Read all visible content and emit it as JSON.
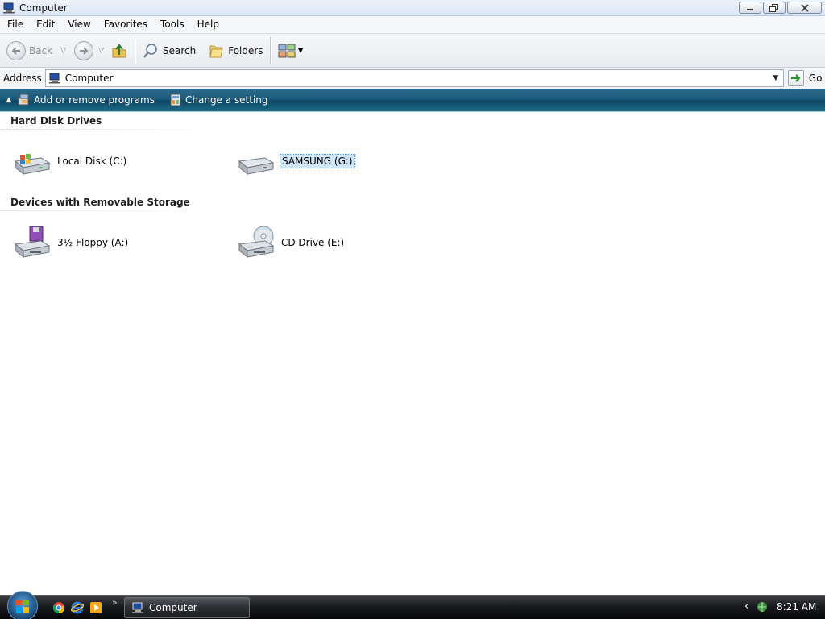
{
  "window": {
    "title": "Computer"
  },
  "menu": {
    "items": [
      "File",
      "Edit",
      "View",
      "Favorites",
      "Tools",
      "Help"
    ]
  },
  "toolbar": {
    "back_label": "Back",
    "search_label": "Search",
    "folders_label": "Folders"
  },
  "address": {
    "label": "Address",
    "value": "Computer",
    "go_label": "Go"
  },
  "tasks": {
    "add_remove_label": "Add or remove programs",
    "change_setting_label": "Change a setting"
  },
  "groups": {
    "hard_disks": {
      "title": "Hard Disk Drives",
      "drives": [
        {
          "label": "Local Disk (C:)",
          "icon": "hard-drive-windows-icon",
          "selected": false
        },
        {
          "label": "SAMSUNG (G:)",
          "icon": "hard-drive-icon",
          "selected": true
        }
      ]
    },
    "removable": {
      "title": "Devices with Removable Storage",
      "drives": [
        {
          "label": "3½ Floppy (A:)",
          "icon": "floppy-drive-icon",
          "selected": false
        },
        {
          "label": "CD Drive (E:)",
          "icon": "cd-drive-icon",
          "selected": false
        }
      ]
    }
  },
  "taskbar": {
    "window_button_label": "Computer",
    "clock": "8:21 AM"
  },
  "colors": {
    "taskband": "#1b5b7c",
    "selection": "#cfe6f6",
    "taskbar": "#1a1b1e"
  }
}
